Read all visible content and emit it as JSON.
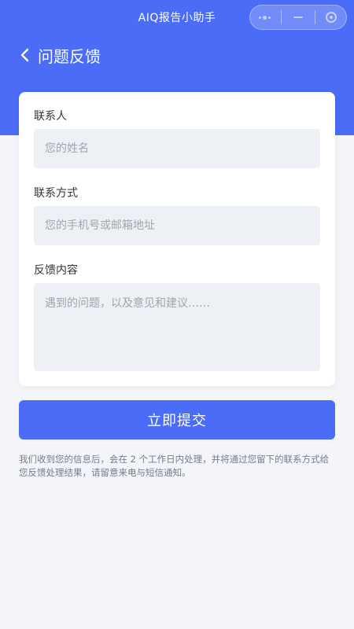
{
  "app": {
    "title": "AIQ报告小助手"
  },
  "capsule": {
    "more_icon": "more-dots-icon",
    "minimize_icon": "minimize-icon",
    "close_icon": "close-circle-icon"
  },
  "nav": {
    "back_icon": "chevron-left-icon",
    "title": "问题反馈"
  },
  "form": {
    "contact_label": "联系人",
    "contact_placeholder": "您的姓名",
    "method_label": "联系方式",
    "method_placeholder": "您的手机号或邮箱地址",
    "content_label": "反馈内容",
    "content_placeholder": "遇到的问题，以及意见和建议……"
  },
  "submit_label": "立即提交",
  "notice": "我们收到您的信息后，会在 2 个工作日内处理，并将通过您留下的联系方式给您反馈处理结果，请留意来电与短信通知。",
  "colors": {
    "accent": "#4a6cf7",
    "background": "#f4f5fa",
    "input_bg": "#edf0f4"
  }
}
